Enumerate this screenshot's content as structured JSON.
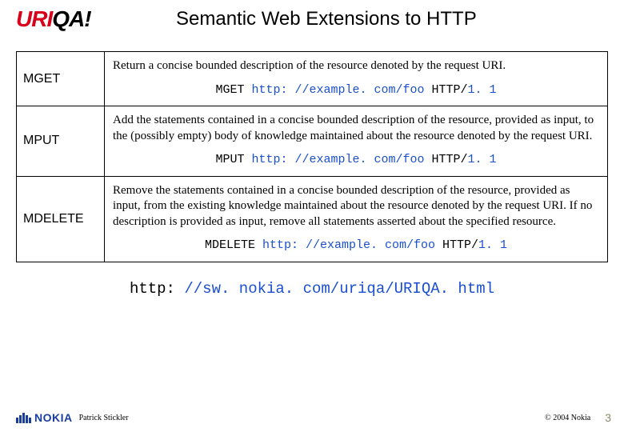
{
  "logo": {
    "part1": "URI",
    "part2": "QA!"
  },
  "title": "Semantic Web Extensions to HTTP",
  "rows": [
    {
      "method": "MGET",
      "desc": "Return a concise bounded description of the resource denoted by the request URI.",
      "code": {
        "method": "MGET",
        "url": "http: //example. com/foo",
        "proto": " HTTP/",
        "ver": "1. 1"
      }
    },
    {
      "method": "MPUT",
      "desc": "Add the statements contained in a concise bounded description of the resource, provided as input, to the (possibly empty) body of knowledge maintained about the resource denoted by the request URI.",
      "code": {
        "method": "MPUT",
        "url": "http: //example. com/foo",
        "proto": " HTTP/",
        "ver": "1. 1"
      }
    },
    {
      "method": "MDELETE",
      "desc": "Remove the statements contained in a concise bounded description of the resource, provided as input, from the existing knowledge maintained about the resource denoted by the request URI. If no description is provided as input, remove all statements asserted about the specified resource.",
      "code": {
        "method": "MDELETE",
        "url": "http: //example. com/foo",
        "proto": " HTTP/",
        "ver": "1. 1"
      }
    }
  ],
  "main_url": {
    "scheme": "http: ",
    "rest": "//sw. nokia. com/uriqa/URIQA. html"
  },
  "footer": {
    "brand": "NOKIA",
    "author": "Patrick Stickler",
    "copyright": "© 2004 Nokia",
    "slide": "3"
  }
}
